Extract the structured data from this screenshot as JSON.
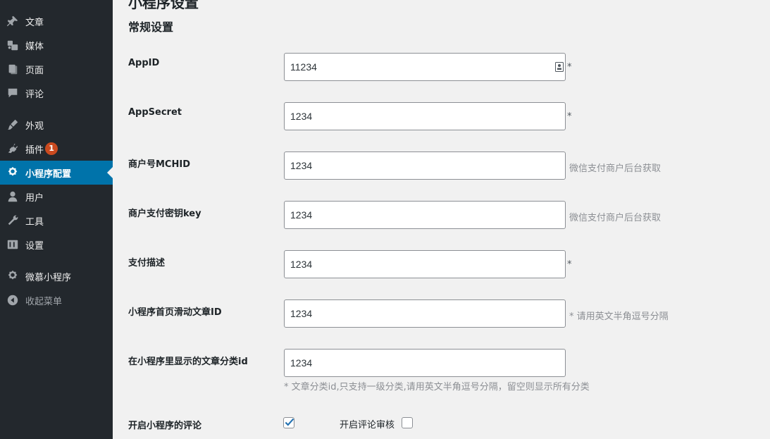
{
  "page": {
    "title": "小程序设置",
    "section_title": "常规设置"
  },
  "sidebar": {
    "items": [
      {
        "label": "文章",
        "icon": "pin-icon"
      },
      {
        "label": "媒体",
        "icon": "media-icon"
      },
      {
        "label": "页面",
        "icon": "pages-icon"
      },
      {
        "label": "评论",
        "icon": "comments-icon"
      },
      {
        "label": "外观",
        "icon": "appearance-icon"
      },
      {
        "label": "插件",
        "icon": "plugins-icon",
        "badge": "1"
      },
      {
        "label": "小程序配置",
        "icon": "miniprogram-icon",
        "active": true
      },
      {
        "label": "用户",
        "icon": "users-icon"
      },
      {
        "label": "工具",
        "icon": "tools-icon"
      },
      {
        "label": "设置",
        "icon": "settings-icon"
      },
      {
        "label": "微慕小程序",
        "icon": "miniprogram-icon"
      },
      {
        "label": "收起菜单",
        "icon": "collapse-icon"
      }
    ]
  },
  "form": {
    "appid": {
      "label": "AppID",
      "value": "11234",
      "required": "*"
    },
    "appsecret": {
      "label": "AppSecret",
      "value": "1234",
      "required": "*"
    },
    "mchid": {
      "label": "商户号MCHID",
      "value": "1234",
      "hint": "微信支付商户后台获取"
    },
    "paykey": {
      "label": "商户支付密钥key",
      "value": "1234",
      "hint": "微信支付商户后台获取"
    },
    "paydesc": {
      "label": "支付描述",
      "value": "1234",
      "required": "*"
    },
    "slide_ids": {
      "label": "小程序首页滑动文章ID",
      "value": "1234",
      "hint": "* 请用英文半角逗号分隔"
    },
    "category_ids": {
      "label": "在小程序里显示的文章分类id",
      "value": "1234",
      "hint": "* 文章分类id,只支持一级分类,请用英文半角逗号分隔，留空则显示所有分类"
    },
    "comments": {
      "label": "开启小程序的评论",
      "enabled": true,
      "review_label": "开启评论审核",
      "review_enabled": false
    }
  },
  "colors": {
    "sidebar_bg": "#23282d",
    "active_bg": "#0073aa",
    "badge_bg": "#ca4a1f",
    "page_bg": "#f1f1f1"
  }
}
